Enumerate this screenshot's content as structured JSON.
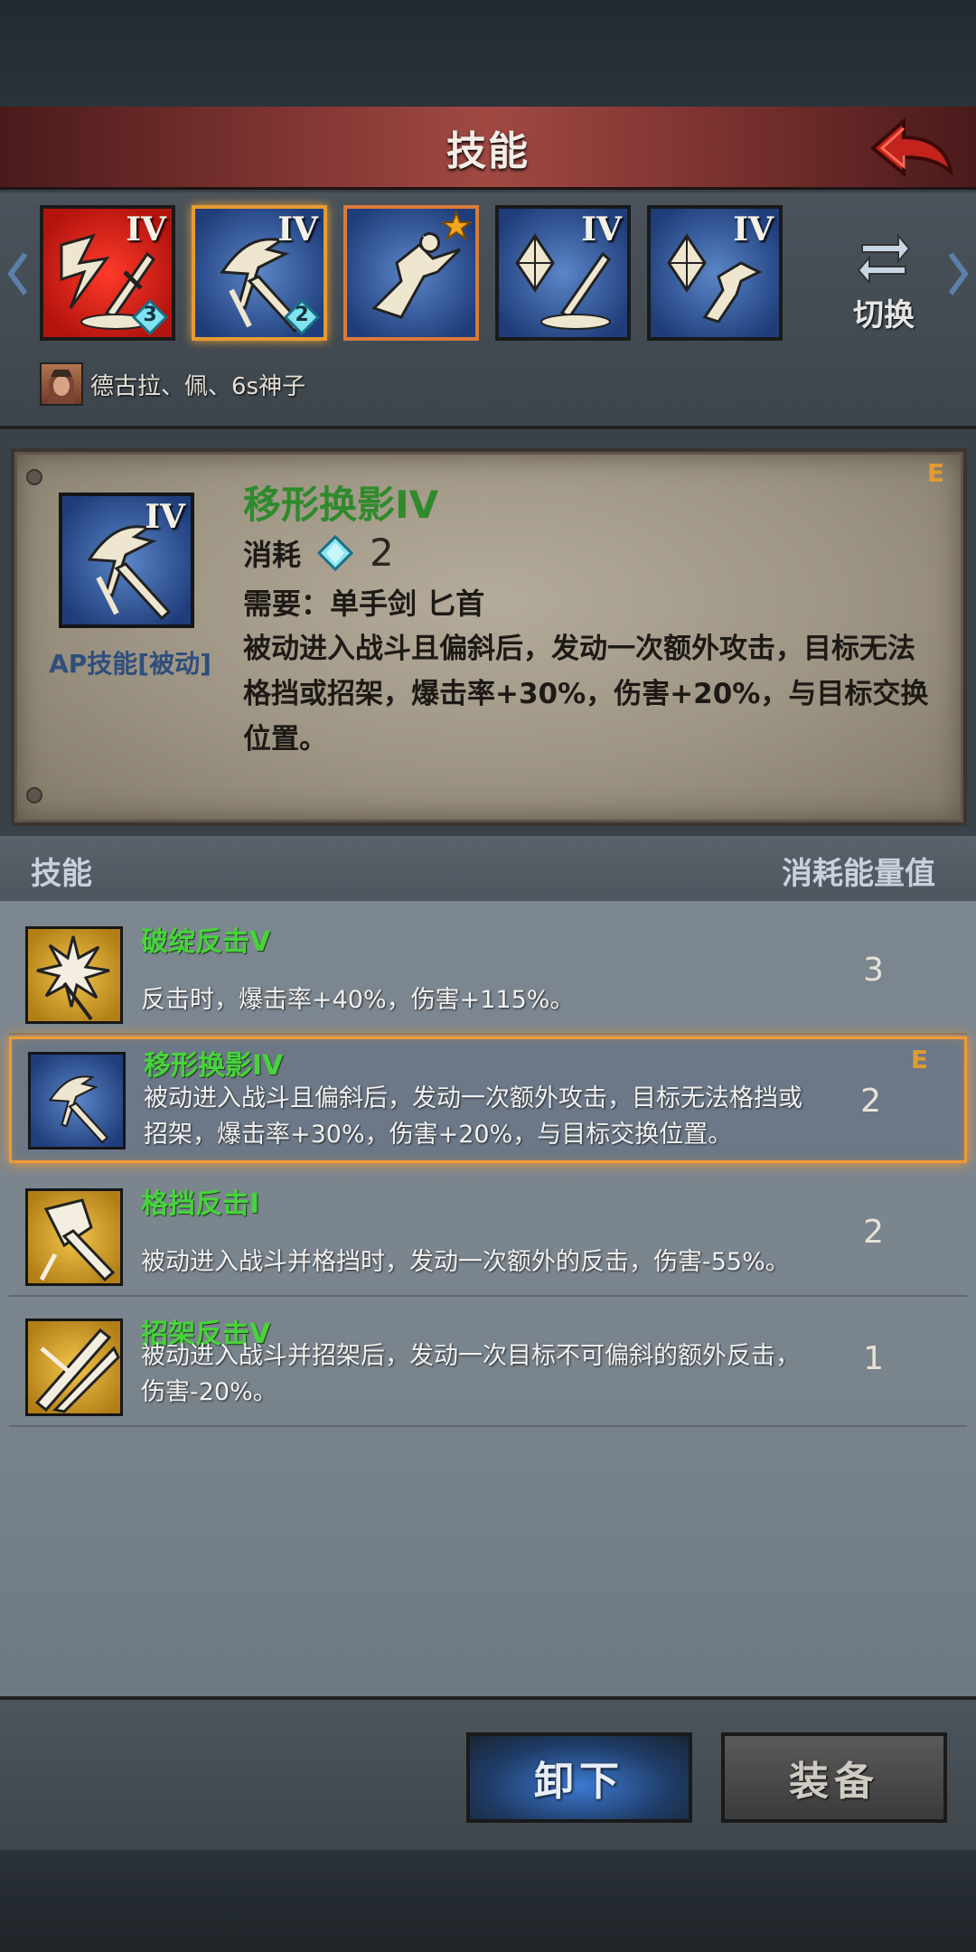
{
  "header": {
    "title": "技能"
  },
  "equipped_skills": [
    {
      "level": "IV",
      "badge_count": "3",
      "color": "#c0201a"
    },
    {
      "level": "IV",
      "badge_count": "2",
      "color": "#2a4c8c"
    },
    {
      "level": "",
      "badge_count": "",
      "color": "#2a4c8c",
      "starred": true
    },
    {
      "level": "IV",
      "badge_count": "",
      "color": "#2a4c8c"
    },
    {
      "level": "IV",
      "badge_count": "",
      "color": "#2a4c8c"
    }
  ],
  "switch": {
    "label": "切换"
  },
  "party": {
    "names": "德古拉、佩、6s神子"
  },
  "detail": {
    "name": "移形换影IV",
    "equipped_tag": "E",
    "cost_label": "消耗",
    "cost_value": "2",
    "requirement": "需要：单手剑 匕首",
    "description": "被动进入战斗且偏斜后，发动一次额外攻击，目标无法格挡或招架，爆击率+30%，伤害+20%，与目标交换位置。",
    "type_label": "AP技能[被动]",
    "icon_level": "IV"
  },
  "list_header": {
    "left": "技能",
    "right": "消耗能量值"
  },
  "skills": [
    {
      "name": "破绽反击V",
      "desc": "反击时，爆击率+40%，伤害+115%。",
      "cost": "3"
    },
    {
      "name": "移形换影IV",
      "desc": "被动进入战斗且偏斜后，发动一次额外攻击，目标无法格挡或招架，爆击率+30%，伤害+20%，与目标交换位置。",
      "cost": "2",
      "equipped_tag": "E"
    },
    {
      "name": "格挡反击I",
      "desc": "被动进入战斗并格挡时，发动一次额外的反击，伤害-55%。",
      "cost": "2"
    },
    {
      "name": "招架反击V",
      "desc": "被动进入战斗并招架后，发动一次目标不可偏斜的额外反击，伤害-20%。",
      "cost": "1"
    }
  ],
  "buttons": {
    "unequip": "卸下",
    "equip": "装备"
  },
  "colors": {
    "accent_orange": "#f29a35",
    "skill_name_green": "#48d23c",
    "title_red": "#a04943"
  }
}
